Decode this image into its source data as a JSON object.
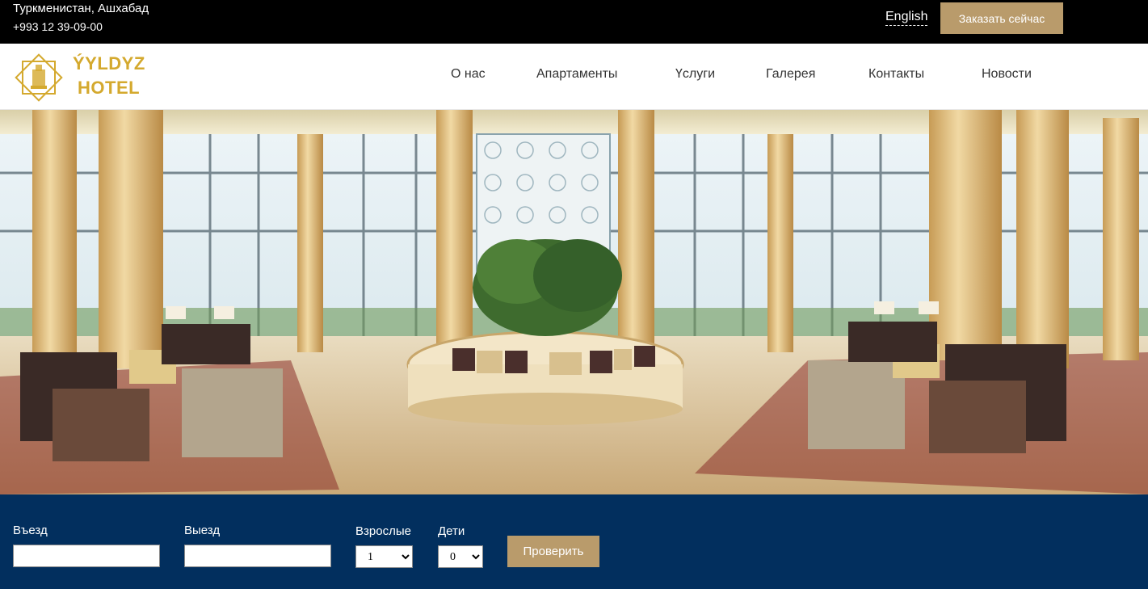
{
  "topbar": {
    "location": "Туркменистан, Ашхабад",
    "phone": "+993 12 39-09-00",
    "language_link": "English",
    "book_button": "Заказать сейчас"
  },
  "header": {
    "logo_icon": "star-emblem-icon",
    "brand_line1": "ÝYLDYZ",
    "brand_line2": "HOTEL",
    "nav": [
      "О нас",
      "Апартаменты",
      "Үслуги",
      "Галерея",
      "Контакты",
      "Новости"
    ]
  },
  "hero": {
    "image": "hotel-lobby-photo"
  },
  "booking": {
    "checkin_label": "Въезд",
    "checkin_value": "",
    "checkout_label": "Выезд",
    "checkout_value": "",
    "adults_label": "Взрослые",
    "adults_value": "1",
    "children_label": "Дети",
    "children_value": "0",
    "check_button": "Проверить"
  },
  "colors": {
    "accent_gold": "#b99b6b",
    "brand_gold": "#d4a92e",
    "booking_bg": "#022f5e",
    "topbar_bg": "#000000"
  }
}
